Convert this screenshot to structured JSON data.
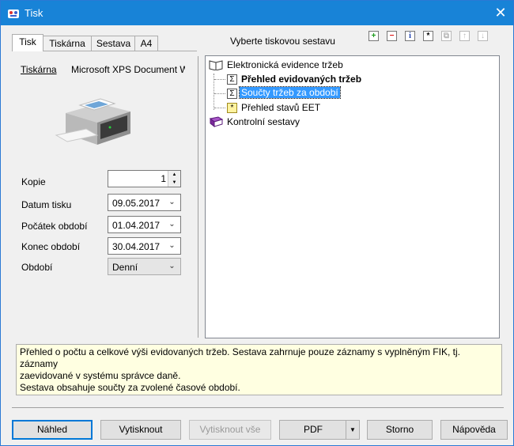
{
  "window": {
    "title": "Tisk",
    "close_glyph": "✕"
  },
  "tabs": [
    {
      "label": "Tisk"
    },
    {
      "label": "Tiskárna"
    },
    {
      "label": "Sestava"
    },
    {
      "label": "A4"
    }
  ],
  "printer": {
    "label": "Tiskárna",
    "value": "Microsoft XPS Document W"
  },
  "form": {
    "copies_label": "Kopie",
    "copies_value": "1",
    "print_date_label": "Datum tisku",
    "print_date_value": "09.05.2017",
    "period_start_label": "Počátek období",
    "period_start_value": "01.04.2017",
    "period_end_label": "Konec období",
    "period_end_value": "30.04.2017",
    "period_label": "Období",
    "period_value": "Denní"
  },
  "report_panel": {
    "title": "Vyberte tiskovou sestavu",
    "toolbar_icons": [
      "add-icon",
      "remove-icon",
      "info-icon",
      "new-icon",
      "copy-icon",
      "move-up-icon",
      "move-down-icon"
    ],
    "tree": {
      "group1": "Elektronická evidence tržeb",
      "item1": "Přehled evidovaných tržeb",
      "item2": "Součty tržeb za období",
      "item3": "Přehled stavů EET",
      "group2": "Kontrolní sestavy"
    }
  },
  "description": {
    "line1": "Přehled o počtu a celkové výši evidovaných tržeb. Sestava zahrnuje pouze záznamy s vyplněným FIK, tj. záznamy",
    "line2": "zaevidované v systému správce daně.",
    "line3": "Sestava obsahuje součty za zvolené časové období."
  },
  "buttons": {
    "preview": "Náhled",
    "print": "Vytisknout",
    "print_all": "Vytisknout vše",
    "pdf": "PDF",
    "cancel": "Storno",
    "help": "Nápověda"
  },
  "colors": {
    "titlebar": "#1883d7",
    "selection": "#3399ff",
    "description_bg": "#ffffe1"
  }
}
